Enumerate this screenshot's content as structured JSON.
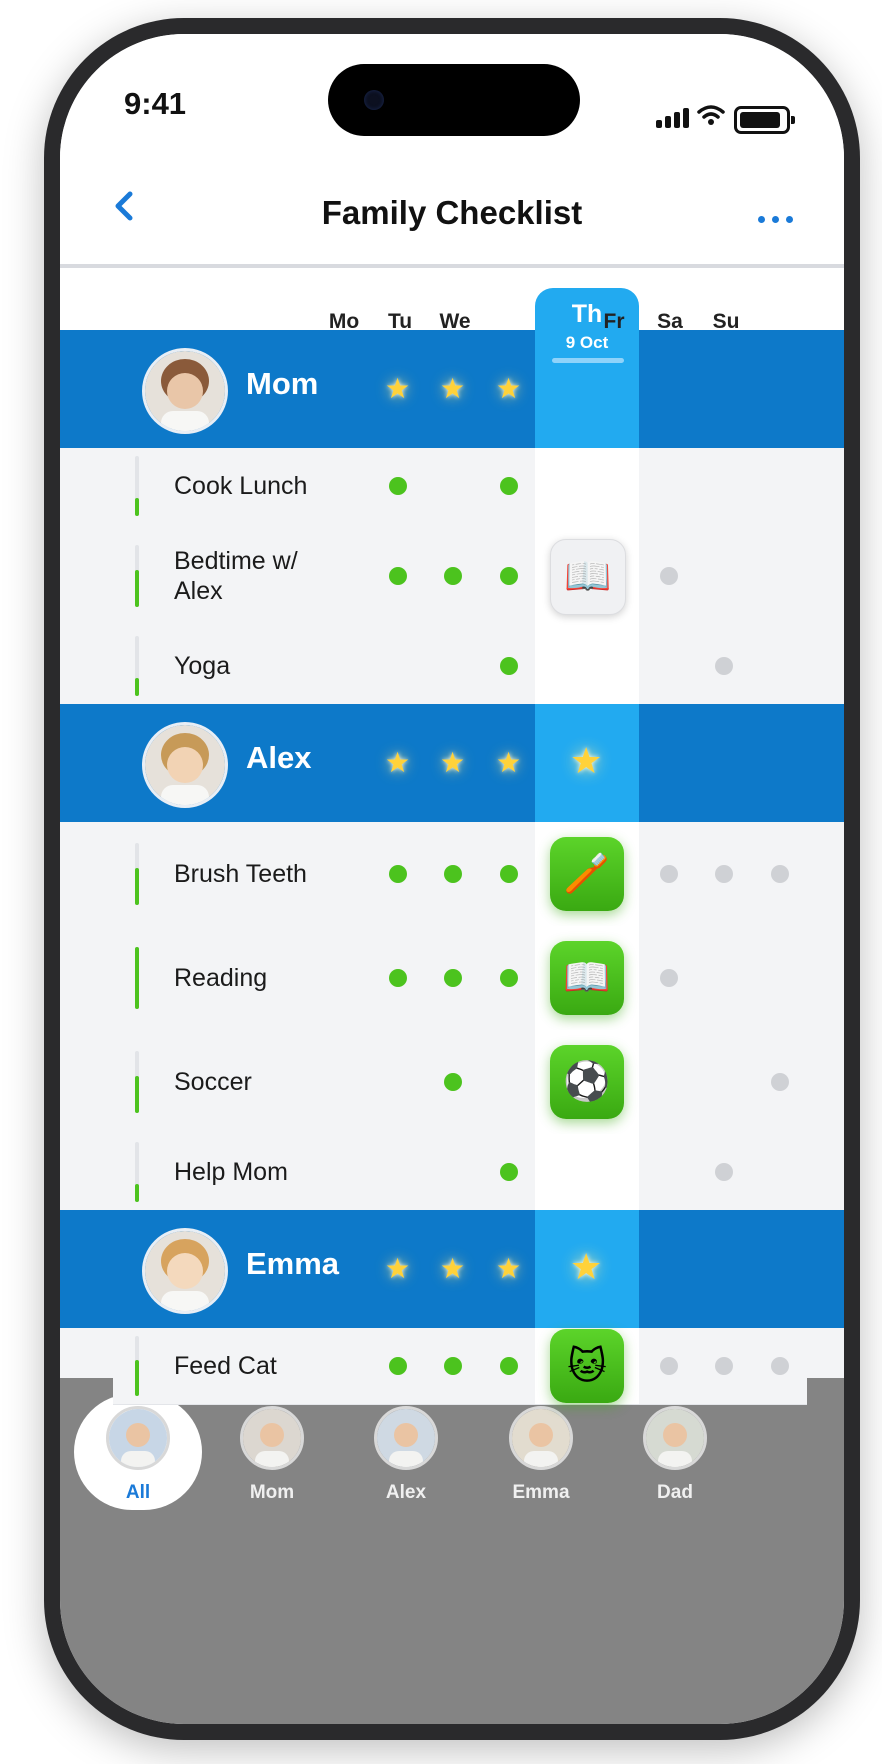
{
  "status_bar": {
    "time": "9:41"
  },
  "nav": {
    "back_icon": "‹",
    "title": "Family Checklist",
    "more_icon": "ellipsis-icon"
  },
  "days": [
    {
      "label": "Mo"
    },
    {
      "label": "Tu"
    },
    {
      "label": "We"
    },
    {
      "label": "Th",
      "sub": "9 Oct",
      "today": true
    },
    {
      "label": "Fr"
    },
    {
      "label": "Sa"
    },
    {
      "label": "Su"
    }
  ],
  "people": [
    {
      "name": "Mom",
      "stars": [
        "Mo",
        "Tu",
        "We"
      ],
      "tasks": [
        {
          "name": "Cook Lunch",
          "done": [
            "Mo",
            "We"
          ],
          "pending": [],
          "badge": null
        },
        {
          "name": "Bedtime w/\nAlex",
          "done": [
            "Mo",
            "Tu",
            "We"
          ],
          "pending": [
            "Fr"
          ],
          "badge": {
            "icon": "📖",
            "style": "grey"
          }
        },
        {
          "name": "Yoga",
          "done": [
            "We"
          ],
          "pending": [
            "Sa"
          ],
          "badge": null
        }
      ]
    },
    {
      "name": "Alex",
      "stars": [
        "Mo",
        "Tu",
        "We",
        "Th"
      ],
      "tasks": [
        {
          "name": "Brush Teeth",
          "done": [
            "Mo",
            "Tu",
            "We"
          ],
          "pending": [
            "Fr",
            "Sa",
            "Su"
          ],
          "badge": {
            "icon": "🪥",
            "style": "green"
          }
        },
        {
          "name": "Reading",
          "done": [
            "Mo",
            "Tu",
            "We"
          ],
          "pending": [
            "Fr"
          ],
          "badge": {
            "icon": "📖",
            "style": "green"
          }
        },
        {
          "name": "Soccer",
          "done": [
            "Tu"
          ],
          "pending": [
            "Su"
          ],
          "badge": {
            "icon": "⚽",
            "style": "green"
          }
        },
        {
          "name": "Help Mom",
          "done": [
            "We"
          ],
          "pending": [
            "Sa"
          ],
          "badge": null
        }
      ]
    },
    {
      "name": "Emma",
      "stars": [
        "Mo",
        "Tu",
        "We",
        "Th"
      ],
      "tasks": [
        {
          "name": "Feed Cat",
          "done": [
            "Mo",
            "Tu",
            "We"
          ],
          "pending": [
            "Fr",
            "Sa",
            "Su"
          ],
          "badge": {
            "icon": "🐱",
            "style": "green"
          }
        }
      ]
    }
  ],
  "tabs": [
    {
      "label": "All",
      "active": true
    },
    {
      "label": "Mom"
    },
    {
      "label": "Alex"
    },
    {
      "label": "Emma"
    },
    {
      "label": "Dad"
    }
  ],
  "colors": {
    "accent": "#1a7ad8",
    "person_row": "#0d79c9",
    "today": "#22aaf0",
    "done": "#4cc31e",
    "pending": "#cfd1d5"
  }
}
